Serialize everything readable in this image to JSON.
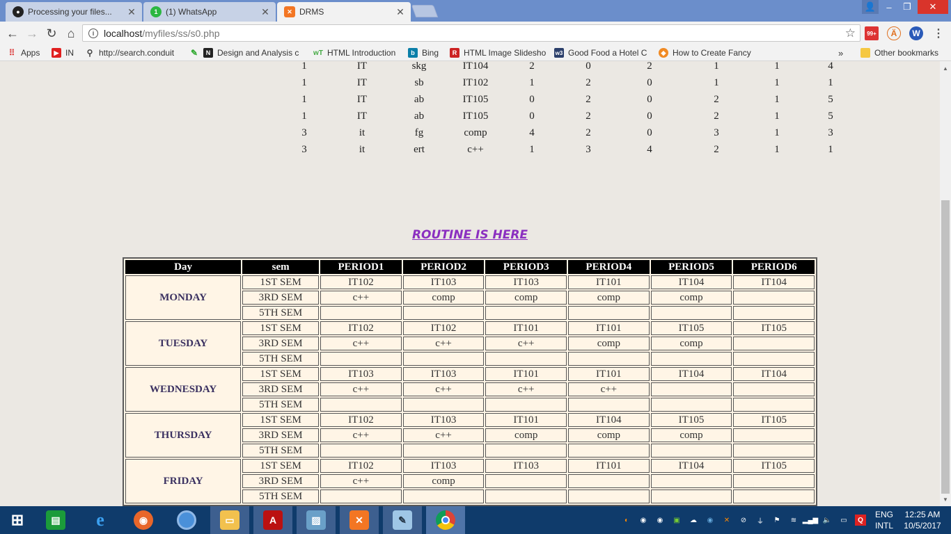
{
  "browser": {
    "tabs": [
      {
        "title": "Processing your files...",
        "icon": "github-icon"
      },
      {
        "title": "(1) WhatsApp",
        "icon": "whatsapp-icon",
        "badge": "1"
      },
      {
        "title": "DRMS",
        "icon": "xampp-icon",
        "active": true
      }
    ],
    "url_host": "localhost",
    "url_path": "/myfiles/ss/s0.php",
    "ext_mail_badge": "99+",
    "bookmarks": [
      {
        "label": "Apps",
        "icon": "apps-grid-icon"
      },
      {
        "label": "IN",
        "icon": "youtube-icon"
      },
      {
        "label": "http://search.conduit",
        "icon": "search-icon"
      },
      {
        "label": "Design and Analysis c",
        "icon": "bookmark-n-icon"
      },
      {
        "label": "HTML Introduction",
        "icon": "html-icon"
      },
      {
        "label": "Bing",
        "icon": "bing-icon"
      },
      {
        "label": "HTML Image Slidesho",
        "icon": "pdf-icon"
      },
      {
        "label": "Good Food a Hotel C",
        "icon": "w3-icon"
      },
      {
        "label": "How to Create Fancy",
        "icon": "box-icon"
      }
    ],
    "bookmarks_overflow": "»",
    "other_bookmarks": "Other bookmarks"
  },
  "top_table": {
    "rows": [
      [
        "1",
        "IT",
        "skg",
        "IT104",
        "2",
        "0",
        "2",
        "1",
        "1",
        "4"
      ],
      [
        "1",
        "IT",
        "sb",
        "IT102",
        "1",
        "2",
        "0",
        "1",
        "1",
        "1"
      ],
      [
        "1",
        "IT",
        "ab",
        "IT105",
        "0",
        "2",
        "0",
        "2",
        "1",
        "5"
      ],
      [
        "1",
        "IT",
        "ab",
        "IT105",
        "0",
        "2",
        "0",
        "2",
        "1",
        "5"
      ],
      [
        "3",
        "it",
        "fg",
        "comp",
        "4",
        "2",
        "0",
        "3",
        "1",
        "3"
      ],
      [
        "3",
        "it",
        "ert",
        "c++",
        "1",
        "3",
        "4",
        "2",
        "1",
        "1"
      ]
    ]
  },
  "routine": {
    "heading": "ROUTINE IS HERE",
    "headers": [
      "Day",
      "sem",
      "PERIOD1",
      "PERIOD2",
      "PERIOD3",
      "PERIOD4",
      "PERIOD5",
      "PERIOD6"
    ],
    "days": [
      {
        "day": "MONDAY",
        "rows": [
          {
            "sem": "1ST SEM",
            "p": [
              "IT102",
              "IT103",
              "IT103",
              "IT101",
              "IT104",
              "IT104"
            ]
          },
          {
            "sem": "3RD SEM",
            "p": [
              "c++",
              "comp",
              "comp",
              "comp",
              "comp",
              ""
            ]
          },
          {
            "sem": "5TH SEM",
            "p": [
              "",
              "",
              "",
              "",
              "",
              ""
            ]
          }
        ]
      },
      {
        "day": "TUESDAY",
        "rows": [
          {
            "sem": "1ST SEM",
            "p": [
              "IT102",
              "IT102",
              "IT101",
              "IT101",
              "IT105",
              "IT105"
            ]
          },
          {
            "sem": "3RD SEM",
            "p": [
              "c++",
              "c++",
              "c++",
              "comp",
              "comp",
              ""
            ]
          },
          {
            "sem": "5TH SEM",
            "p": [
              "",
              "",
              "",
              "",
              "",
              ""
            ]
          }
        ]
      },
      {
        "day": "WEDNESDAY",
        "rows": [
          {
            "sem": "1ST SEM",
            "p": [
              "IT103",
              "IT103",
              "IT101",
              "IT101",
              "IT104",
              "IT104"
            ]
          },
          {
            "sem": "3RD SEM",
            "p": [
              "c++",
              "c++",
              "c++",
              "c++",
              "",
              ""
            ]
          },
          {
            "sem": "5TH SEM",
            "p": [
              "",
              "",
              "",
              "",
              "",
              ""
            ]
          }
        ]
      },
      {
        "day": "THURSDAY",
        "rows": [
          {
            "sem": "1ST SEM",
            "p": [
              "IT102",
              "IT103",
              "IT101",
              "IT104",
              "IT105",
              "IT105"
            ]
          },
          {
            "sem": "3RD SEM",
            "p": [
              "c++",
              "c++",
              "comp",
              "comp",
              "comp",
              ""
            ]
          },
          {
            "sem": "5TH SEM",
            "p": [
              "",
              "",
              "",
              "",
              "",
              ""
            ]
          }
        ]
      },
      {
        "day": "FRIDAY",
        "rows": [
          {
            "sem": "1ST SEM",
            "p": [
              "IT102",
              "IT103",
              "IT103",
              "IT101",
              "IT104",
              "IT105"
            ]
          },
          {
            "sem": "3RD SEM",
            "p": [
              "c++",
              "comp",
              "",
              "",
              "",
              ""
            ]
          },
          {
            "sem": "5TH SEM",
            "p": [
              "",
              "",
              "",
              "",
              "",
              ""
            ]
          }
        ]
      }
    ]
  },
  "taskbar": {
    "apps": [
      "start-icon",
      "store-icon",
      "internet-explorer-icon",
      "firefox-icon",
      "chrome-canary-icon",
      "file-explorer-icon",
      "acrobat-icon",
      "photos-icon",
      "xampp-icon",
      "notepad-icon",
      "chrome-icon"
    ],
    "lang_top": "ENG",
    "lang_bottom": "INTL",
    "time": "12:25 AM",
    "date": "10/5/2017"
  },
  "colors": {
    "tab_strip": "#6b8ecb",
    "page_bg": "#ebe8e3",
    "heading": "#8b2fc0",
    "table_header_bg": "#000000",
    "cell_bg": "#fff5e6",
    "taskbar": "#0f3b6b"
  }
}
